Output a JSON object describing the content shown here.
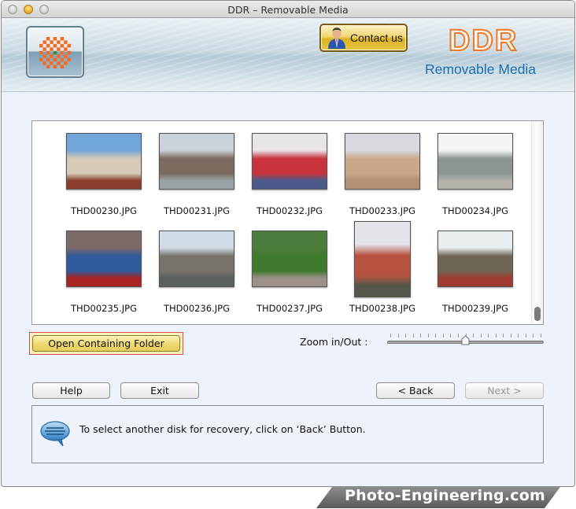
{
  "window": {
    "title": "DDR – Removable Media",
    "controls": [
      "close",
      "minimize",
      "zoom"
    ]
  },
  "header": {
    "logo_icon": "checkered-sunburst-logo-icon",
    "contact_button": {
      "label": "Contact us",
      "icon": "person-avatar-icon"
    },
    "brand": {
      "name": "DDR",
      "subtitle": "Removable Media"
    },
    "colors": {
      "brand_orange": "#f07a23",
      "brand_blue": "#1b6fb5",
      "contact_gold": "#e6c23e"
    }
  },
  "gallery": {
    "items": [
      {
        "filename": "THD00230.JPG",
        "colors": [
          "#6fa5d8",
          "#d7cbb8",
          "#8a3d2c"
        ]
      },
      {
        "filename": "THD00231.JPG",
        "colors": [
          "#c9d2da",
          "#7b6a5d",
          "#9aa2a6"
        ]
      },
      {
        "filename": "THD00232.JPG",
        "colors": [
          "#e9e3ea",
          "#c9343c",
          "#4b5a8a"
        ]
      },
      {
        "filename": "THD00233.JPG",
        "colors": [
          "#d7d9df",
          "#c9a88a",
          "#b38f74"
        ]
      },
      {
        "filename": "THD00234.JPG",
        "colors": [
          "#f3f5f4",
          "#8c9591",
          "#b4b2aa"
        ]
      },
      {
        "filename": "THD00235.JPG",
        "colors": [
          "#7b6a68",
          "#2f5a9c",
          "#a9231f"
        ]
      },
      {
        "filename": "THD00236.JPG",
        "colors": [
          "#cfdbe7",
          "#77726a",
          "#5a5f60"
        ]
      },
      {
        "filename": "THD00237.JPG",
        "colors": [
          "#4d7d3d",
          "#3e7a2e",
          "#9c9088"
        ]
      },
      {
        "filename": "THD00238.JPG",
        "colors": [
          "#e4e3ea",
          "#b7523f",
          "#53584a"
        ]
      },
      {
        "filename": "THD00239.JPG",
        "colors": [
          "#e8eef0",
          "#6e6553",
          "#a23b2f"
        ]
      }
    ],
    "scroll_position_percent": 100
  },
  "actions": {
    "open_folder_label": "Open Containing Folder",
    "zoom_label": "Zoom in/Out :",
    "zoom_slider_value_percent": 50,
    "zoom_slider_ticks": 21
  },
  "nav": {
    "help_label": "Help",
    "exit_label": "Exit",
    "back_label": "< Back",
    "next_label": "Next >",
    "next_enabled": false
  },
  "status": {
    "icon": "speech-bubble-icon",
    "message": "To select another disk for recovery, click on ‘Back’ Button."
  },
  "watermark": {
    "text": "Photo-Engineering.com"
  }
}
